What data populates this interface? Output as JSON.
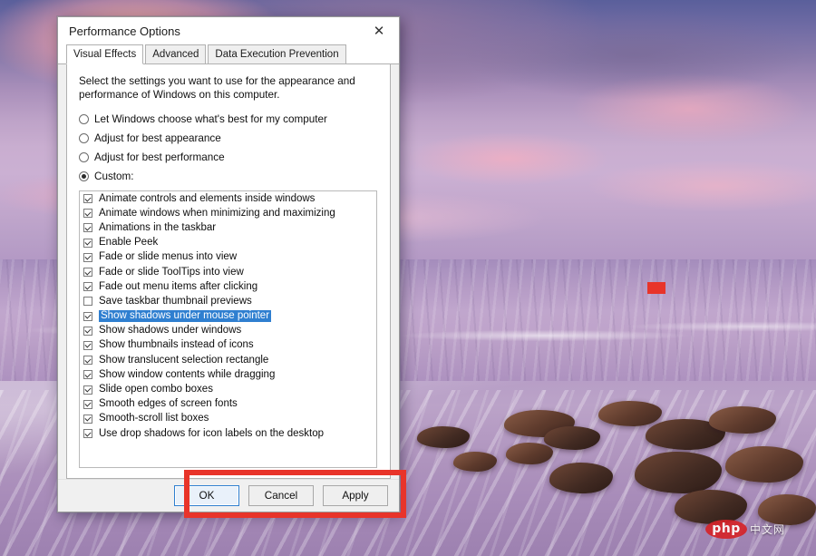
{
  "dialog": {
    "title": "Performance Options",
    "close_icon": "close-icon",
    "tabs": [
      {
        "label": "Visual Effects",
        "active": true
      },
      {
        "label": "Advanced",
        "active": false
      },
      {
        "label": "Data Execution Prevention",
        "active": false
      }
    ],
    "intro": "Select the settings you want to use for the appearance and performance of Windows on this computer.",
    "radios": [
      {
        "label": "Let Windows choose what's best for my computer",
        "selected": false
      },
      {
        "label": "Adjust for best appearance",
        "selected": false
      },
      {
        "label": "Adjust for best performance",
        "selected": false
      },
      {
        "label": "Custom:",
        "selected": true
      }
    ],
    "effects": [
      {
        "label": "Animate controls and elements inside windows",
        "checked": true,
        "selected": false
      },
      {
        "label": "Animate windows when minimizing and maximizing",
        "checked": true,
        "selected": false
      },
      {
        "label": "Animations in the taskbar",
        "checked": true,
        "selected": false
      },
      {
        "label": "Enable Peek",
        "checked": true,
        "selected": false
      },
      {
        "label": "Fade or slide menus into view",
        "checked": true,
        "selected": false
      },
      {
        "label": "Fade or slide ToolTips into view",
        "checked": true,
        "selected": false
      },
      {
        "label": "Fade out menu items after clicking",
        "checked": true,
        "selected": false
      },
      {
        "label": "Save taskbar thumbnail previews",
        "checked": false,
        "selected": false
      },
      {
        "label": "Show shadows under mouse pointer",
        "checked": true,
        "selected": true
      },
      {
        "label": "Show shadows under windows",
        "checked": true,
        "selected": false
      },
      {
        "label": "Show thumbnails instead of icons",
        "checked": true,
        "selected": false
      },
      {
        "label": "Show translucent selection rectangle",
        "checked": true,
        "selected": false
      },
      {
        "label": "Show window contents while dragging",
        "checked": true,
        "selected": false
      },
      {
        "label": "Slide open combo boxes",
        "checked": true,
        "selected": false
      },
      {
        "label": "Smooth edges of screen fonts",
        "checked": true,
        "selected": false
      },
      {
        "label": "Smooth-scroll list boxes",
        "checked": true,
        "selected": false
      },
      {
        "label": "Use drop shadows for icon labels on the desktop",
        "checked": true,
        "selected": false
      }
    ],
    "buttons": [
      {
        "label": "OK",
        "focused": true
      },
      {
        "label": "Cancel",
        "focused": false
      },
      {
        "label": "Apply",
        "focused": false
      }
    ]
  },
  "annotations": {
    "button_row_highlight_color": "#e8342a",
    "sea_marker_color": "#e8342a"
  },
  "watermark": {
    "brand": "php",
    "suffix": "中文网"
  },
  "colors": {
    "selection_blue": "#2f7fd0",
    "dialog_face": "#f0f0f0",
    "panel_white": "#ffffff",
    "annotation_red": "#e8342a"
  }
}
